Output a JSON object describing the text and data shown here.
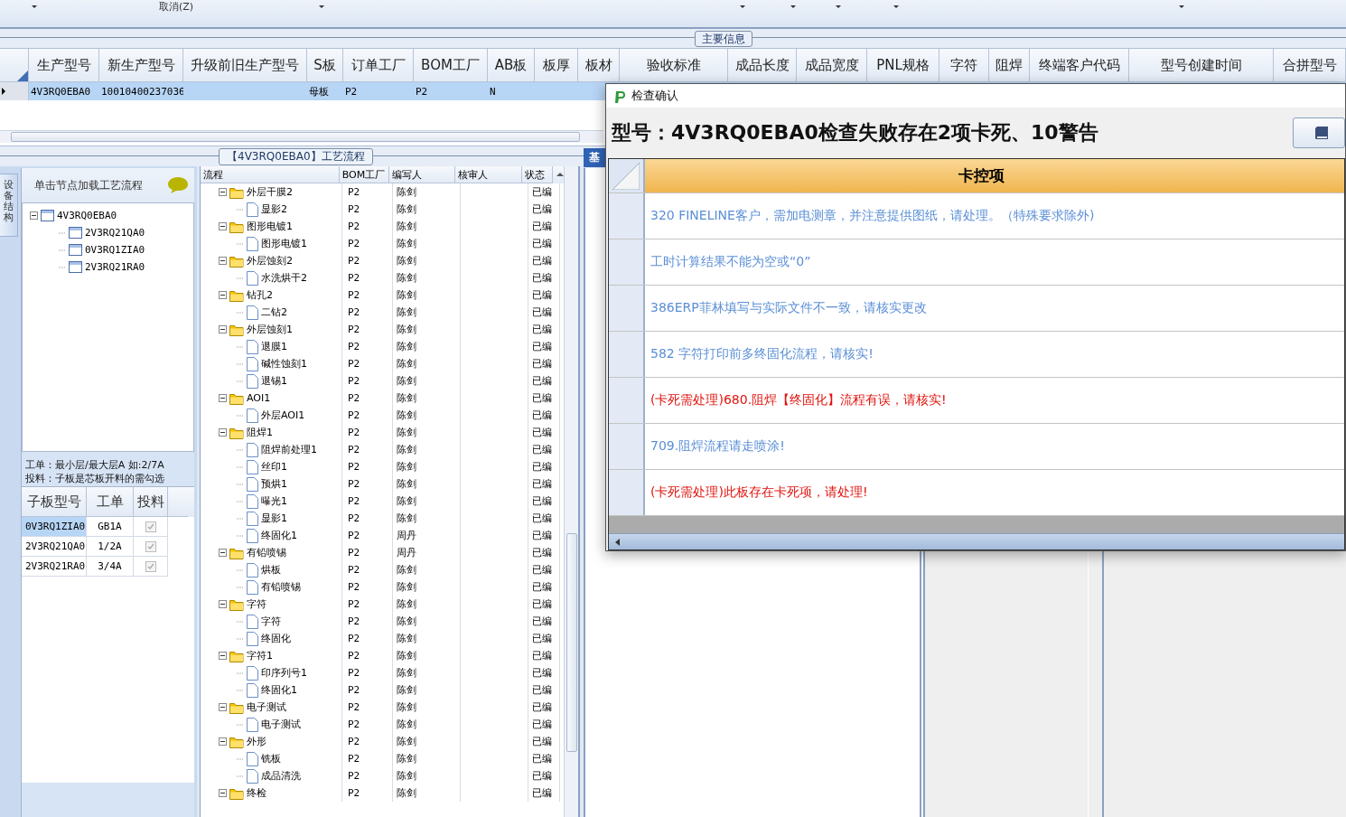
{
  "toolbar": {
    "cancel_button": "取消(Z)"
  },
  "group_label": "主要信息",
  "main_grid": {
    "columns": [
      "生产型号",
      "新生产型号",
      "升级前旧生产型号",
      "S板",
      "订单工厂",
      "BOM工厂",
      "AB板",
      "板厚",
      "板材",
      "验收标准",
      "成品长度",
      "成品宽度",
      "PNL规格",
      "字符",
      "阻焊",
      "终端客户代码",
      "型号创建时间",
      "合拼型号"
    ],
    "rows": [
      {
        "selected": true,
        "model": "4V3RQ0EBA0",
        "new_model": "10010400237036",
        "s_board": "母板",
        "order_factory": "P2",
        "bom_factory": "P2",
        "ab_board": "N"
      }
    ]
  },
  "flow_tab": "【4V3RQ0EBA0】工艺流程",
  "device_panel": {
    "side_tab": "设备结构",
    "hint": "单击节点加载工艺流程",
    "tree": [
      {
        "name": "4V3RQ0EBA0",
        "expanded": true,
        "children": [
          {
            "name": "2V3RQ21QA0"
          },
          {
            "name": "0V3RQ1ZIA0"
          },
          {
            "name": "2V3RQ21RA0"
          }
        ]
      }
    ],
    "notes": [
      "工单：最小层/最大层A 如:2/7A",
      "投料：子板是芯板开料的需勾选"
    ],
    "sub_boards": {
      "columns": [
        "子板型号",
        "工单",
        "投料"
      ],
      "rows": [
        {
          "model": "0V3RQ1ZIA0",
          "order": "GB1A",
          "fed": true,
          "selected": true
        },
        {
          "model": "2V3RQ21QA0",
          "order": "1/2A",
          "fed": true,
          "selected": false
        },
        {
          "model": "2V3RQ21RA0",
          "order": "3/4A",
          "fed": true,
          "selected": false
        }
      ]
    }
  },
  "flow": {
    "columns": [
      "流程",
      "BOM工厂",
      "编写人",
      "核审人",
      "状态"
    ],
    "steps": [
      {
        "name": "外层干膜2",
        "bom": "P2",
        "writer": "陈剑",
        "status": "已编",
        "expanded": true,
        "children": [
          {
            "name": "显影2",
            "bom": "P2",
            "writer": "陈剑",
            "status": "已编"
          }
        ]
      },
      {
        "name": "图形电镀1",
        "bom": "P2",
        "writer": "陈剑",
        "status": "已编",
        "expanded": true,
        "children": [
          {
            "name": "图形电镀1",
            "bom": "P2",
            "writer": "陈剑",
            "status": "已编"
          }
        ]
      },
      {
        "name": "外层蚀刻2",
        "bom": "P2",
        "writer": "陈剑",
        "status": "已编",
        "expanded": true,
        "children": [
          {
            "name": "水洗烘干2",
            "bom": "P2",
            "writer": "陈剑",
            "status": "已编"
          }
        ]
      },
      {
        "name": "钻孔2",
        "bom": "P2",
        "writer": "陈剑",
        "status": "已编",
        "expanded": true,
        "children": [
          {
            "name": "二钻2",
            "bom": "P2",
            "writer": "陈剑",
            "status": "已编"
          }
        ]
      },
      {
        "name": "外层蚀刻1",
        "bom": "P2",
        "writer": "陈剑",
        "status": "已编",
        "expanded": true,
        "children": [
          {
            "name": "退膜1",
            "bom": "P2",
            "writer": "陈剑",
            "status": "已编"
          },
          {
            "name": "碱性蚀刻1",
            "bom": "P2",
            "writer": "陈剑",
            "status": "已编"
          },
          {
            "name": "退锡1",
            "bom": "P2",
            "writer": "陈剑",
            "status": "已编"
          }
        ]
      },
      {
        "name": "AOI1",
        "bom": "P2",
        "writer": "陈剑",
        "status": "已编",
        "expanded": true,
        "children": [
          {
            "name": "外层AOI1",
            "bom": "P2",
            "writer": "陈剑",
            "status": "已编"
          }
        ]
      },
      {
        "name": "阻焊1",
        "bom": "P2",
        "writer": "陈剑",
        "status": "已编",
        "expanded": true,
        "children": [
          {
            "name": "阻焊前处理1",
            "bom": "P2",
            "writer": "陈剑",
            "status": "已编"
          },
          {
            "name": "丝印1",
            "bom": "P2",
            "writer": "陈剑",
            "status": "已编"
          },
          {
            "name": "预烘1",
            "bom": "P2",
            "writer": "陈剑",
            "status": "已编"
          },
          {
            "name": "曝光1",
            "bom": "P2",
            "writer": "陈剑",
            "status": "已编"
          },
          {
            "name": "显影1",
            "bom": "P2",
            "writer": "陈剑",
            "status": "已编"
          },
          {
            "name": "终固化1",
            "bom": "P2",
            "writer": "周丹",
            "status": "已编"
          }
        ]
      },
      {
        "name": "有铅喷锡",
        "bom": "P2",
        "writer": "周丹",
        "status": "已编",
        "expanded": true,
        "children": [
          {
            "name": "烘板",
            "bom": "P2",
            "writer": "陈剑",
            "status": "已编"
          },
          {
            "name": "有铅喷锡",
            "bom": "P2",
            "writer": "陈剑",
            "status": "已编"
          }
        ]
      },
      {
        "name": "字符",
        "bom": "P2",
        "writer": "陈剑",
        "status": "已编",
        "expanded": true,
        "children": [
          {
            "name": "字符",
            "bom": "P2",
            "writer": "陈剑",
            "status": "已编"
          },
          {
            "name": "终固化",
            "bom": "P2",
            "writer": "陈剑",
            "status": "已编"
          }
        ]
      },
      {
        "name": "字符1",
        "bom": "P2",
        "writer": "陈剑",
        "status": "已编",
        "expanded": true,
        "children": [
          {
            "name": "印序列号1",
            "bom": "P2",
            "writer": "陈剑",
            "status": "已编"
          },
          {
            "name": "终固化1",
            "bom": "P2",
            "writer": "陈剑",
            "status": "已编"
          }
        ]
      },
      {
        "name": "电子测试",
        "bom": "P2",
        "writer": "陈剑",
        "status": "已编",
        "expanded": true,
        "children": [
          {
            "name": "电子测试",
            "bom": "P2",
            "writer": "陈剑",
            "status": "已编"
          }
        ]
      },
      {
        "name": "外形",
        "bom": "P2",
        "writer": "陈剑",
        "status": "已编",
        "expanded": true,
        "children": [
          {
            "name": "铣板",
            "bom": "P2",
            "writer": "陈剑",
            "status": "已编"
          },
          {
            "name": "成品清洗",
            "bom": "P2",
            "writer": "陈剑",
            "status": "已编"
          }
        ]
      },
      {
        "name": "终检",
        "bom": "P2",
        "writer": "陈剑",
        "status": "已编",
        "expanded": true
      }
    ]
  },
  "detail_tab": "基",
  "dialog": {
    "title": "检查确认",
    "heading": "型号：4V3RQ0EBA0检查失败存在2项卡死、10警告",
    "column": "卡控项",
    "items": [
      {
        "kind": "warning",
        "text": "320 FINELINE客户，需加电测章，并注意提供图纸，请处理。（特殊要求除外)"
      },
      {
        "kind": "warning",
        "text": "工时计算结果不能为空或“0”"
      },
      {
        "kind": "warning",
        "text": "386ERP菲林填写与实际文件不一致，请核实更改"
      },
      {
        "kind": "warning",
        "text": "582 字符打印前多终固化流程，请核实!"
      },
      {
        "kind": "blocking",
        "text": "(卡死需处理)680.阻焊【终固化】流程有误，请核实!"
      },
      {
        "kind": "warning",
        "text": "709.阻焊流程请走喷涂!"
      },
      {
        "kind": "blocking",
        "text": "(卡死需处理)此板存在卡死项，请处理!"
      }
    ]
  }
}
